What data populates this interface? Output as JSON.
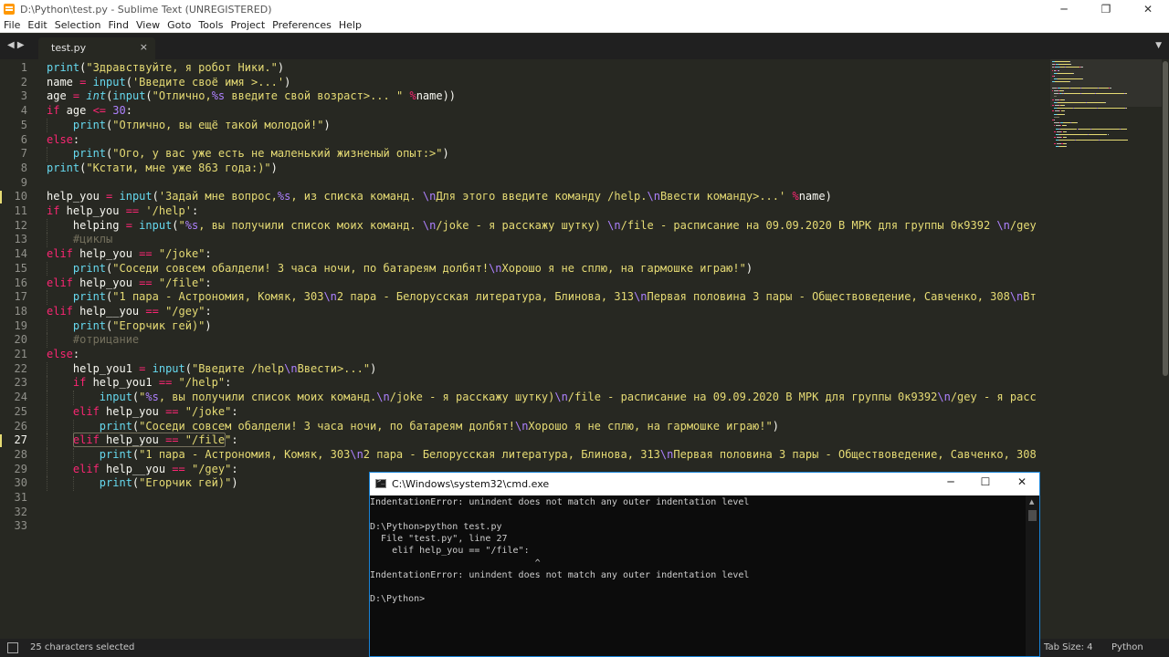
{
  "window": {
    "title": "D:\\Python\\test.py - Sublime Text (UNREGISTERED)",
    "minimize_glyph": "─",
    "restore_glyph": "❐",
    "close_glyph": "✕"
  },
  "menu": [
    "File",
    "Edit",
    "Selection",
    "Find",
    "View",
    "Goto",
    "Tools",
    "Project",
    "Preferences",
    "Help"
  ],
  "tabs": {
    "nav_glyph": "◀ ▶",
    "active_title": "test.py",
    "close_glyph": "×",
    "menu_glyph": "▼"
  },
  "editor": {
    "line_numbers": [
      "1",
      "2",
      "3",
      "4",
      "5",
      "6",
      "7",
      "8",
      "9",
      "10",
      "11",
      "12",
      "13",
      "14",
      "15",
      "16",
      "17",
      "18",
      "19",
      "20",
      "21",
      "22",
      "23",
      "24",
      "25",
      "26",
      "27",
      "28",
      "29",
      "30",
      "31",
      "32",
      "33"
    ],
    "current_line": "27",
    "modified_lines": [
      "10",
      "27"
    ],
    "lines": [
      [
        [
          "fn",
          "print"
        ],
        [
          "",
          "("
        ],
        [
          "st",
          "\"Здравствуйте, я робот Ники.\""
        ],
        [
          "",
          ")"
        ]
      ],
      [
        [
          "",
          "name "
        ],
        [
          "op",
          "="
        ],
        [
          "",
          " "
        ],
        [
          "fn",
          "input"
        ],
        [
          "",
          "("
        ],
        [
          "st",
          "'Введите своё имя >...'"
        ],
        [
          "",
          ")"
        ]
      ],
      [
        [
          "",
          "age "
        ],
        [
          "op",
          "="
        ],
        [
          "",
          " "
        ],
        [
          "ty",
          "int"
        ],
        [
          "",
          "("
        ],
        [
          "fn",
          "input"
        ],
        [
          "",
          "("
        ],
        [
          "st",
          "\"Отлично,"
        ],
        [
          "nm",
          "%s"
        ],
        [
          "st",
          " введите свой возраст>... \""
        ],
        [
          "",
          " "
        ],
        [
          "op",
          "%"
        ],
        [
          "",
          "name))"
        ]
      ],
      [
        [
          "kw",
          "if"
        ],
        [
          "",
          " age "
        ],
        [
          "op",
          "<="
        ],
        [
          "",
          " "
        ],
        [
          "nm",
          "30"
        ],
        [
          "",
          ":"
        ]
      ],
      [
        [
          "",
          "    "
        ],
        [
          "fn",
          "print"
        ],
        [
          "",
          "("
        ],
        [
          "st",
          "\"Отлично, вы ещё такой молодой!\""
        ],
        [
          "",
          ")"
        ]
      ],
      [
        [
          "kw",
          "else"
        ],
        [
          "",
          ":"
        ]
      ],
      [
        [
          "",
          "    "
        ],
        [
          "fn",
          "print"
        ],
        [
          "",
          "("
        ],
        [
          "st",
          "\"Ого, у вас уже есть не маленький жизненый опыт:>\""
        ],
        [
          "",
          ")"
        ]
      ],
      [
        [
          "fn",
          "print"
        ],
        [
          "",
          "("
        ],
        [
          "st",
          "\"Кстати, мне уже 863 года:)\""
        ],
        [
          "",
          ")"
        ]
      ],
      [],
      [
        [
          "",
          "help_you "
        ],
        [
          "op",
          "="
        ],
        [
          "",
          " "
        ],
        [
          "fn",
          "input"
        ],
        [
          "",
          "("
        ],
        [
          "st",
          "'Задай мне вопрос,"
        ],
        [
          "nm",
          "%s"
        ],
        [
          "st",
          ", из списка команд. "
        ],
        [
          "nm",
          "\\n"
        ],
        [
          "st",
          "Для этого введите команду /help."
        ],
        [
          "nm",
          "\\n"
        ],
        [
          "st",
          "Ввести команду>...'"
        ],
        [
          "",
          " "
        ],
        [
          "op",
          "%"
        ],
        [
          "",
          "name)"
        ]
      ],
      [
        [
          "kw",
          "if"
        ],
        [
          "",
          " help_you "
        ],
        [
          "op",
          "=="
        ],
        [
          "",
          " "
        ],
        [
          "st",
          "'/help'"
        ],
        [
          "",
          ":"
        ]
      ],
      [
        [
          "",
          "    helping "
        ],
        [
          "op",
          "="
        ],
        [
          "",
          " "
        ],
        [
          "fn",
          "input"
        ],
        [
          "",
          "("
        ],
        [
          "st",
          "\""
        ],
        [
          "nm",
          "%s"
        ],
        [
          "st",
          ", вы получили список моих команд. "
        ],
        [
          "nm",
          "\\n"
        ],
        [
          "st",
          "/joke - я расскажу шутку) "
        ],
        [
          "nm",
          "\\n"
        ],
        [
          "st",
          "/file - расписание на 09.09.2020 В МРК для группы 0к9392 "
        ],
        [
          "nm",
          "\\n"
        ],
        [
          "st",
          "/gey"
        ]
      ],
      [
        [
          "",
          "    "
        ],
        [
          "cm",
          "#циклы"
        ]
      ],
      [
        [
          "kw",
          "elif"
        ],
        [
          "",
          " help_you "
        ],
        [
          "op",
          "=="
        ],
        [
          "",
          " "
        ],
        [
          "st",
          "\"/joke\""
        ],
        [
          "",
          ":"
        ]
      ],
      [
        [
          "",
          "    "
        ],
        [
          "fn",
          "print"
        ],
        [
          "",
          "("
        ],
        [
          "st",
          "\"Соседи совсем обалдели! 3 часа ночи, по батареям долбят!"
        ],
        [
          "nm",
          "\\n"
        ],
        [
          "st",
          "Хорошо я не сплю, на гармошке играю!\""
        ],
        [
          "",
          ")"
        ]
      ],
      [
        [
          "kw",
          "elif"
        ],
        [
          "",
          " help_you "
        ],
        [
          "op",
          "=="
        ],
        [
          "",
          " "
        ],
        [
          "st",
          "\"/file\""
        ],
        [
          "",
          ":"
        ]
      ],
      [
        [
          "",
          "    "
        ],
        [
          "fn",
          "print"
        ],
        [
          "",
          "("
        ],
        [
          "st",
          "\"1 пара - Астрономия, Комяк, 303"
        ],
        [
          "nm",
          "\\n"
        ],
        [
          "st",
          "2 пара - Белорусская литература, Блинова, 313"
        ],
        [
          "nm",
          "\\n"
        ],
        [
          "st",
          "Первая половина 3 пары - Обществоведение, Савченко, 308"
        ],
        [
          "nm",
          "\\n"
        ],
        [
          "st",
          "Вт"
        ]
      ],
      [
        [
          "kw",
          "elif"
        ],
        [
          "",
          " help__you "
        ],
        [
          "op",
          "=="
        ],
        [
          "",
          " "
        ],
        [
          "st",
          "\"/gey\""
        ],
        [
          "",
          ":"
        ]
      ],
      [
        [
          "",
          "    "
        ],
        [
          "fn",
          "print"
        ],
        [
          "",
          "("
        ],
        [
          "st",
          "\"Егорчик гей)\""
        ],
        [
          "",
          ")"
        ]
      ],
      [
        [
          "",
          "    "
        ],
        [
          "cm",
          "#отрицание"
        ]
      ],
      [
        [
          "kw",
          "else"
        ],
        [
          "",
          ":"
        ]
      ],
      [
        [
          "",
          "    help_you1 "
        ],
        [
          "op",
          "="
        ],
        [
          "",
          " "
        ],
        [
          "fn",
          "input"
        ],
        [
          "",
          "("
        ],
        [
          "st",
          "\"Введите /help"
        ],
        [
          "nm",
          "\\n"
        ],
        [
          "st",
          "Ввести>...\""
        ],
        [
          "",
          ")"
        ]
      ],
      [
        [
          "",
          "    "
        ],
        [
          "kw",
          "if"
        ],
        [
          "",
          " help_you1 "
        ],
        [
          "op",
          "=="
        ],
        [
          "",
          " "
        ],
        [
          "st",
          "\"/help\""
        ],
        [
          "",
          ":"
        ]
      ],
      [
        [
          "",
          "        "
        ],
        [
          "fn",
          "input"
        ],
        [
          "",
          "("
        ],
        [
          "st",
          "\""
        ],
        [
          "nm",
          "%s"
        ],
        [
          "st",
          ", вы получили список моих команд."
        ],
        [
          "nm",
          "\\n"
        ],
        [
          "st",
          "/joke - я расскажу шутку)"
        ],
        [
          "nm",
          "\\n"
        ],
        [
          "st",
          "/file - расписание на 09.09.2020 В МРК для группы 0к9392"
        ],
        [
          "nm",
          "\\n"
        ],
        [
          "st",
          "/gey - я расс"
        ]
      ],
      [
        [
          "",
          "    "
        ],
        [
          "kw",
          "elif"
        ],
        [
          "",
          " help_you "
        ],
        [
          "op",
          "=="
        ],
        [
          "",
          " "
        ],
        [
          "st",
          "\"/joke\""
        ],
        [
          "",
          ":"
        ]
      ],
      [
        [
          "",
          "        "
        ],
        [
          "fn",
          "print"
        ],
        [
          "",
          "("
        ],
        [
          "st",
          "\"Соседи совсем обалдели! 3 часа ночи, по батареям долбят!"
        ],
        [
          "nm",
          "\\n"
        ],
        [
          "st",
          "Хорошо я не сплю, на гармошке играю!\""
        ],
        [
          "",
          ")"
        ]
      ],
      [
        [
          "",
          "    "
        ],
        [
          "kw",
          "elif"
        ],
        [
          "",
          " help_you "
        ],
        [
          "op",
          "=="
        ],
        [
          "",
          " "
        ],
        [
          "st",
          "\"/file\""
        ],
        [
          "",
          ":"
        ]
      ],
      [
        [
          "",
          "        "
        ],
        [
          "fn",
          "print"
        ],
        [
          "",
          "("
        ],
        [
          "st",
          "\"1 пара - Астрономия, Комяк, 303"
        ],
        [
          "nm",
          "\\n"
        ],
        [
          "st",
          "2 пара - Белорусская литература, Блинова, 313"
        ],
        [
          "nm",
          "\\n"
        ],
        [
          "st",
          "Первая половина 3 пары - Обществоведение, Савченко, 308"
        ]
      ],
      [
        [
          "",
          "    "
        ],
        [
          "kw",
          "elif"
        ],
        [
          "",
          " help__you "
        ],
        [
          "op",
          "=="
        ],
        [
          "",
          " "
        ],
        [
          "st",
          "\"/gey\""
        ],
        [
          "",
          ":"
        ]
      ],
      [
        [
          "",
          "        "
        ],
        [
          "fn",
          "print"
        ],
        [
          "",
          "("
        ],
        [
          "st",
          "\"Егорчик гей)\""
        ],
        [
          "",
          ")"
        ]
      ],
      [],
      [],
      []
    ]
  },
  "statusbar": {
    "selection": "25 characters selected",
    "tab_size": "Tab Size: 4",
    "syntax": "Python"
  },
  "cmd": {
    "title": "C:\\Windows\\system32\\cmd.exe",
    "minimize_glyph": "─",
    "maximize_glyph": "☐",
    "close_glyph": "✕",
    "scroll_up_glyph": "▲",
    "output": [
      "IndentationError: unindent does not match any outer indentation level",
      "",
      "D:\\Python>python test.py",
      "  File \"test.py\", line 27",
      "    elif help_you == \"/file\":",
      "                              ^",
      "IndentationError: unindent does not match any outer indentation level",
      "",
      "D:\\Python>"
    ]
  },
  "colors": {
    "editor_bg": "#272822",
    "keyword": "#f92672",
    "function": "#66d9ef",
    "string": "#e6db74",
    "number": "#ae81ff",
    "comment": "#75715e",
    "cmd_border": "#1883d7"
  }
}
